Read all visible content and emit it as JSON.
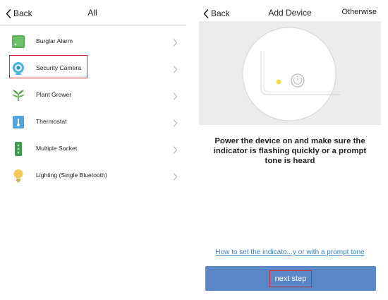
{
  "left": {
    "back_label": "Back",
    "title": "All",
    "devices": [
      {
        "label": "Burglar Alarm",
        "icon": "alarm-icon",
        "color": "#5caf5a"
      },
      {
        "label": "Security Camera",
        "icon": "camera-icon",
        "color": "#45b3e4",
        "highlighted": true
      },
      {
        "label": "Plant Grower",
        "icon": "plant-icon",
        "color": "#5ca14e"
      },
      {
        "label": "Thermostat",
        "icon": "thermostat-icon",
        "color": "#4fa6dc"
      },
      {
        "label": "Multiple Socket",
        "icon": "socket-icon",
        "color": "#3f9a4b"
      },
      {
        "label": "Lighting (Single Bluetooth)",
        "icon": "bulb-icon",
        "color": "#f4c85a"
      }
    ]
  },
  "right": {
    "back_label": "Back",
    "title": "Add Device",
    "other_label": "Otherwise",
    "instruction": "Power the device on and make sure the indicator is flashing quickly or a prompt tone is heard",
    "help_link": "How to set the indicato...y or with a  prompt tone",
    "next_label": "next step",
    "indicator_color": "#f2de3c"
  },
  "colors": {
    "accent": "#5a87c8",
    "highlight": "#d42a2a",
    "link": "#3b82c4"
  }
}
